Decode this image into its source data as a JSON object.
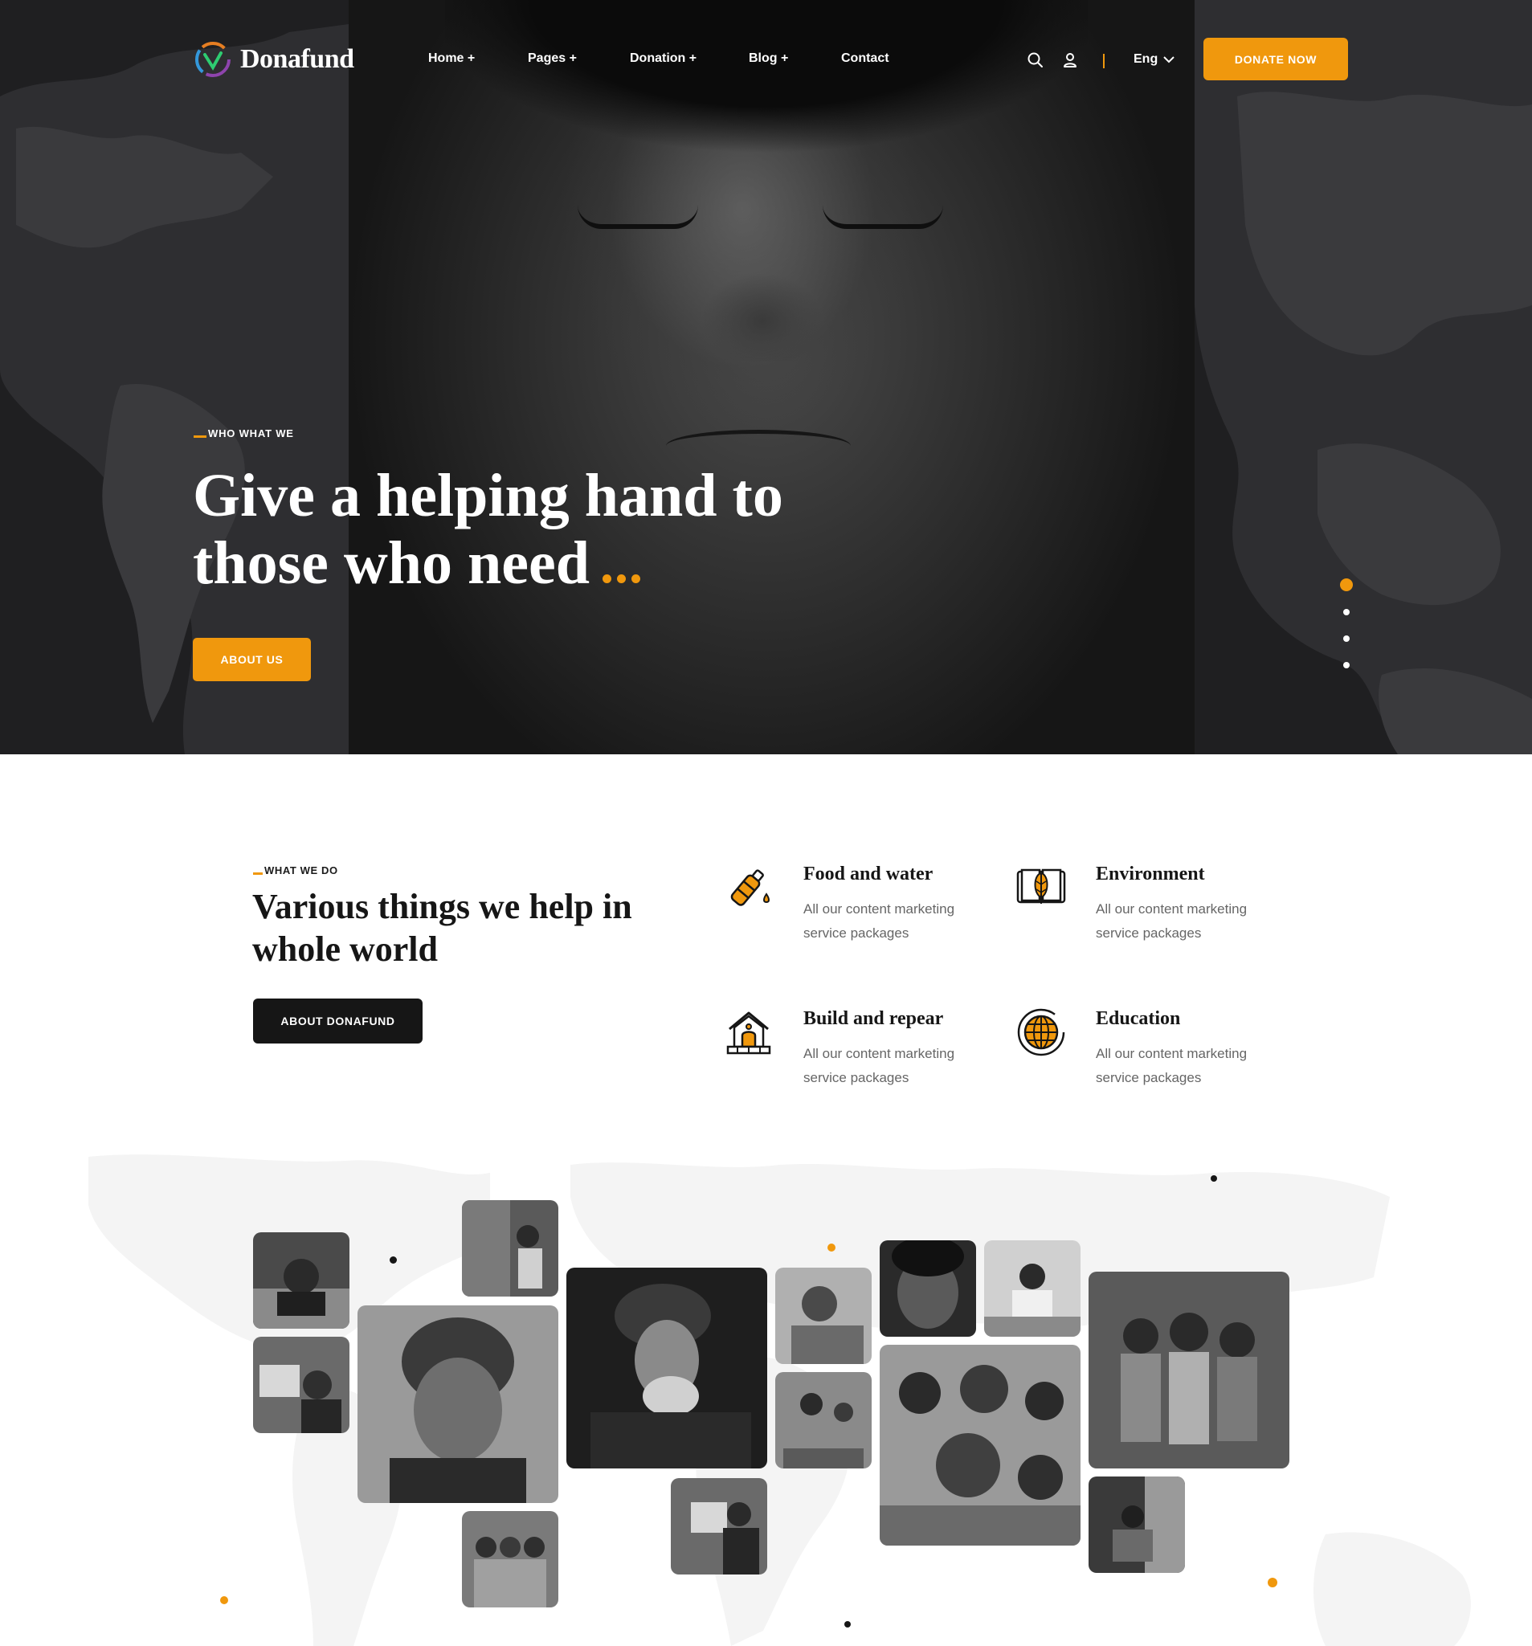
{
  "brand": {
    "name": "Donafund"
  },
  "nav": {
    "menu": [
      "Home +",
      "Pages +",
      "Donation +",
      "Blog +",
      "Contact"
    ],
    "language": "Eng",
    "donate_label": "DONATE NOW",
    "icons": [
      "search-icon",
      "user-icon",
      "chevron-down-icon"
    ]
  },
  "hero": {
    "eyebrow": "WHO WHAT WE",
    "title_line1": "Give a helping hand to",
    "title_line2": "those who need",
    "about_label": "ABOUT US",
    "slides": 4,
    "active_slide": 1
  },
  "what_we_do": {
    "eyebrow": "WHAT WE DO",
    "title": "Various things we help in whole world",
    "button_label": "ABOUT DONAFUND",
    "services": [
      {
        "title": "Food and water",
        "desc": "All our content marketing service packages",
        "icon": "water-bottle-icon"
      },
      {
        "title": "Environment",
        "desc": "All our content marketing service packages",
        "icon": "open-book-icon"
      },
      {
        "title": "Build and repear",
        "desc": "All our content marketing service packages",
        "icon": "house-icon"
      },
      {
        "title": "Education",
        "desc": "All our content marketing service packages",
        "icon": "globe-icon"
      }
    ]
  },
  "colors": {
    "accent": "#f0980d",
    "dark": "#161616",
    "hero_bg": "#1f1f21",
    "muted_text": "#666666"
  }
}
